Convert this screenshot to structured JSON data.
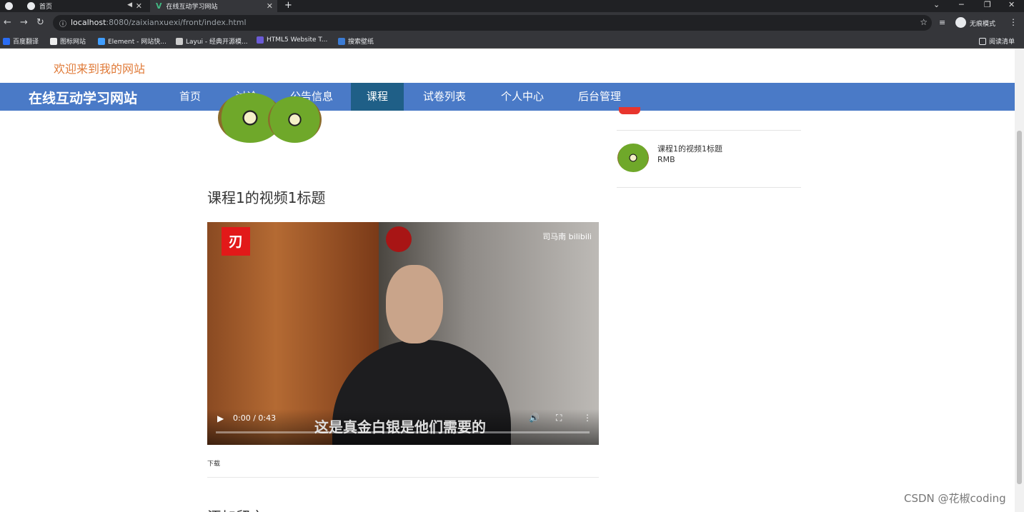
{
  "browser": {
    "tabs": [
      {
        "label": "首页",
        "active": false
      },
      {
        "label": "在线互动学习网站",
        "active": true
      }
    ],
    "new_tab": "+",
    "url_host": "localhost",
    "url_rest": ":8080/zaixianxuexi/front/index.html",
    "profile_label": "无痕模式",
    "reading_list": "阅读清单",
    "bookmarks": [
      "百度翻译",
      "图标网站",
      "Element - 网站快...",
      "Layui - 经典开源模...",
      "HTML5 Website T...",
      "搜索壁纸"
    ]
  },
  "header": {
    "welcome": "欢迎来到我的网站"
  },
  "navbar": {
    "brand": "在线互动学习网站",
    "items": [
      "首页",
      "讨论",
      "公告信息",
      "课程",
      "试卷列表",
      "个人中心",
      "后台管理"
    ],
    "active_item": "课程"
  },
  "main": {
    "title": "课程1的视频1标题",
    "video": {
      "watermark": "司马南 bilibili",
      "subtitle": "这是真金白银是他们需要的",
      "time": "0:00 / 0:43",
      "progress": 0.0
    },
    "download": "下载",
    "comment_heading": "添加留言"
  },
  "sidebar": {
    "item": {
      "title": "课程1的视频1标题",
      "price": "RMB"
    }
  },
  "watermark": "CSDN @花椒coding",
  "colors": {
    "navbar": "#4a7ac7",
    "nav_active": "#1f5f87",
    "welcome": "#e07b39"
  }
}
